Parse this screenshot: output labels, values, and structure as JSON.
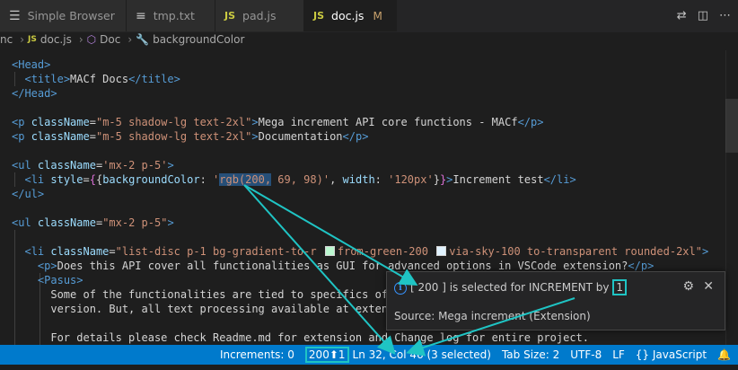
{
  "tabs": [
    {
      "label": "Simple Browser",
      "icon": "menu-icon",
      "glyph": "☰"
    },
    {
      "label": "tmp.txt",
      "icon": "file-text-icon",
      "glyph": "≡"
    },
    {
      "label": "pad.js",
      "icon": "js-file-icon",
      "glyph": "JS"
    },
    {
      "label": "doc.js",
      "icon": "js-file-icon",
      "glyph": "JS",
      "modified": "M"
    }
  ],
  "breadcrumb": {
    "part1": "nc",
    "file_icon": "JS",
    "file": "doc.js",
    "symbol": "Doc",
    "prop": "backgroundColor",
    "sep": "›"
  },
  "code": {
    "l1_tag": "Head",
    "l2_tag": "title",
    "l2_text": "MACf Docs",
    "l3_tag": "Head",
    "l5_tag": "p",
    "l5_attr": "className",
    "l5_val": "\"m-5 shadow-lg text-2xl\"",
    "l5_text": "Mega increment API core functions - MACf",
    "l6_text": "Documentation",
    "l8_tag": "ul",
    "l8_val": "'mx-2 p-5'",
    "l9_tag": "li",
    "l9_attr": "style",
    "l9_prop": "backgroundColor",
    "l9_sel": "rgb(200,",
    "l9_rest": " 69, 98)'",
    "l9_prop2": "width",
    "l9_val2": "'120px'",
    "l9_text": "Increment test",
    "l10_tag": "ul",
    "l12_val": "\"mx-2 p-5\"",
    "l14_val_a": "\"list-disc p-1 bg-gradient-to-r ",
    "l14_val_b": "from-green-200 ",
    "l14_val_c": "via-sky-100 to-transparent rounded-2xl\"",
    "l15_tag": "p",
    "l15_text": "Does this API cover all functionalities as GUI for advanced options in VSCode extension?",
    "l16_tag": "Pasus",
    "l17_text": "Some of the functionalities are tied to specifics of w",
    "l18_text": "version. But, all text processing available at extensi",
    "l20_text": "For details please check Readme.md for extension and Change log for entire project."
  },
  "hover": {
    "message_prefix": "[ 200 ] is selected for INCREMENT by",
    "message_value": "1",
    "source": "Source: Mega increment (Extension)",
    "gear_glyph": "⚙",
    "close_glyph": "✕"
  },
  "status": {
    "increments": "Increments: 0",
    "value_box": "200⬆1",
    "position": "Ln 32, Col 46 (3 selected)",
    "tab_size": "Tab Size: 2",
    "encoding": "UTF-8",
    "eol": "LF",
    "language": "{} JavaScript",
    "bell_glyph": "🔔"
  },
  "colors": {
    "accent": "#007acc",
    "annotation": "#1fc4c4",
    "swatch_green": "#bbf7d0",
    "swatch_sky": "#e0f2fe"
  }
}
